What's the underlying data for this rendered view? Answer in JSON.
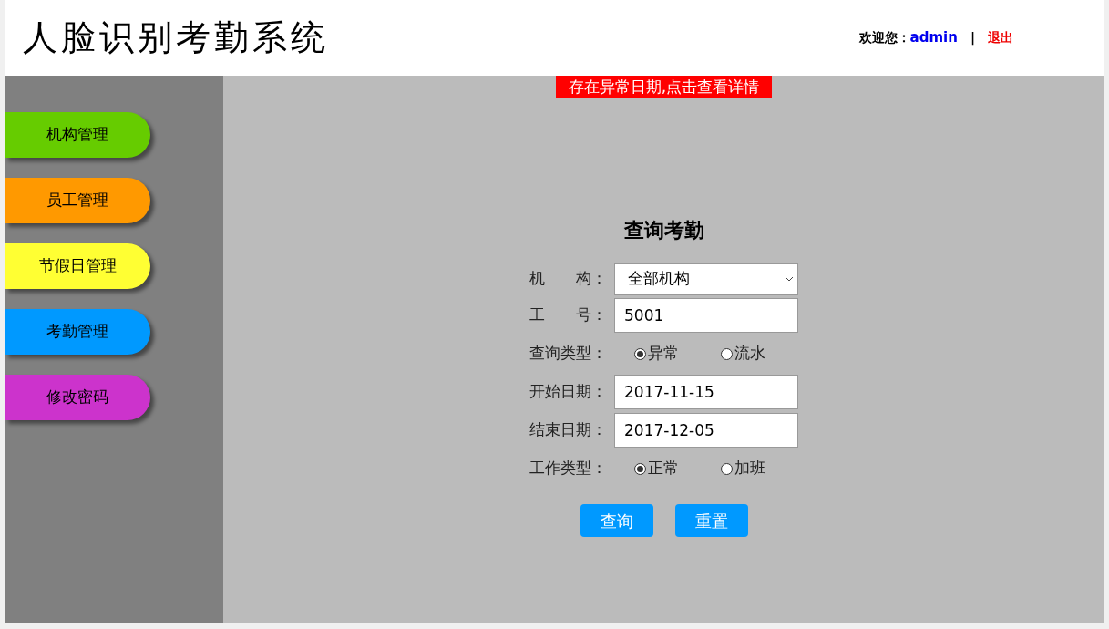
{
  "header": {
    "title": "人脸识别考勤系统",
    "welcome": "欢迎您：",
    "user": "admin",
    "separator": "|",
    "logout": "退出"
  },
  "sidebar": {
    "items": [
      {
        "label": "机构管理",
        "color": "#66cc00"
      },
      {
        "label": "员工管理",
        "color": "#ff9900"
      },
      {
        "label": "节假日管理",
        "color": "#ffff33"
      },
      {
        "label": "考勤管理",
        "color": "#0099ff"
      },
      {
        "label": "修改密码",
        "color": "#cc33cc"
      }
    ]
  },
  "alert": "存在异常日期,点击查看详情",
  "form": {
    "title": "查询考勤",
    "fields": [
      {
        "kind": "select",
        "label": "机　　构：",
        "value": "全部机构"
      },
      {
        "kind": "text",
        "label": "工　　号：",
        "value": "5001"
      },
      {
        "kind": "radio",
        "label": "查询类型：",
        "options": [
          {
            "label": "异常",
            "selected": true
          },
          {
            "label": "流水",
            "selected": false
          }
        ]
      },
      {
        "kind": "text",
        "label": "开始日期：",
        "value": "2017-11-15"
      },
      {
        "kind": "text",
        "label": "结束日期：",
        "value": "2017-12-05"
      },
      {
        "kind": "radio",
        "label": "工作类型：",
        "options": [
          {
            "label": "正常",
            "selected": true
          },
          {
            "label": "加班",
            "selected": false
          }
        ]
      }
    ],
    "buttons": [
      "查询",
      "重置"
    ]
  }
}
